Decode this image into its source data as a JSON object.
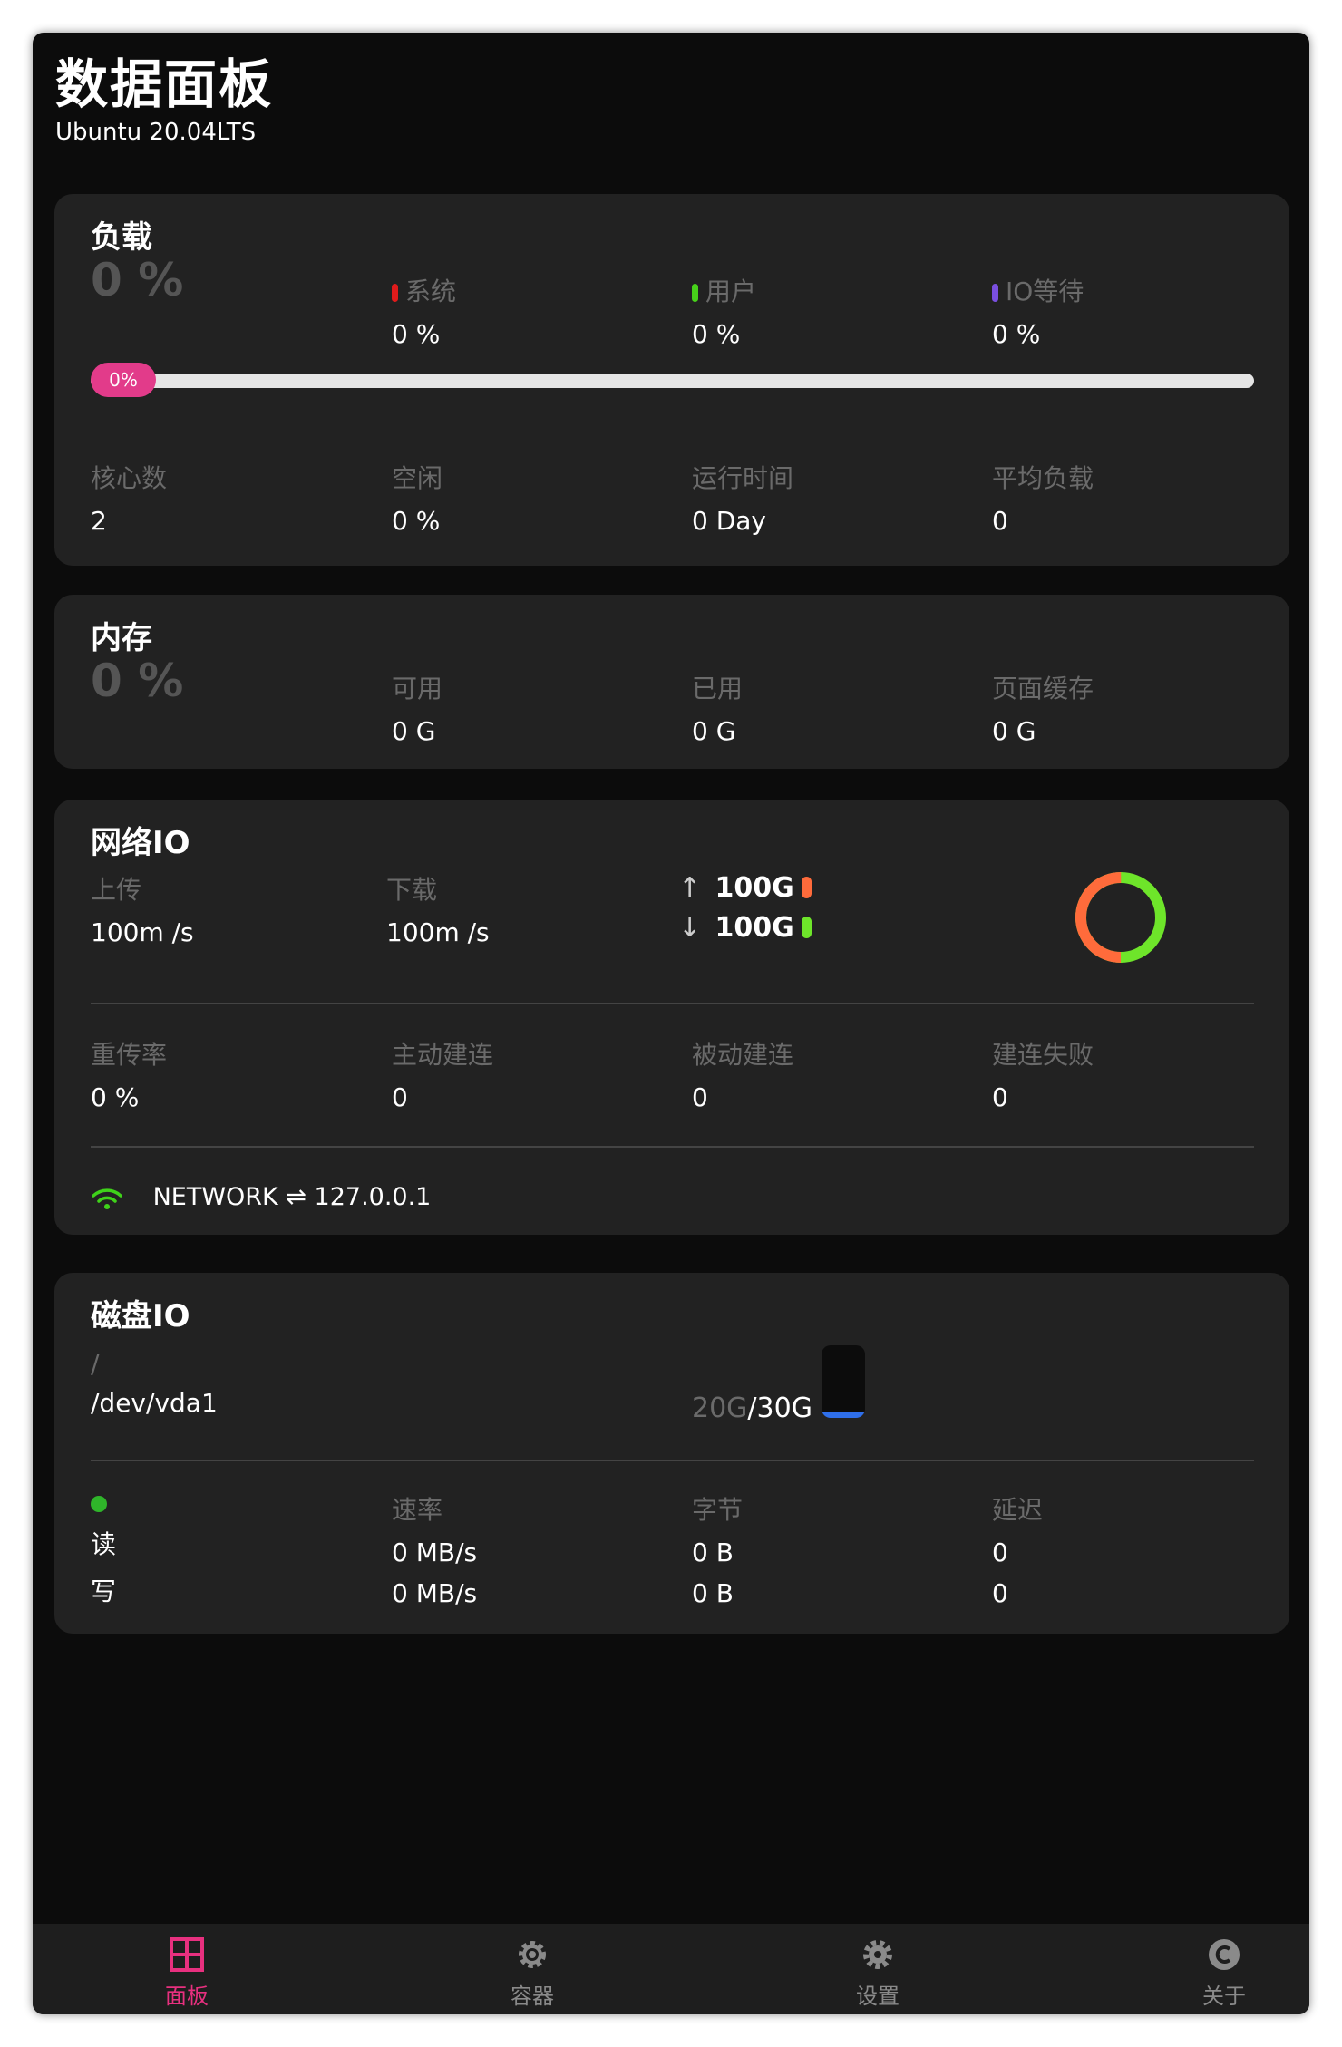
{
  "header": {
    "title": "数据面板",
    "subtitle": "Ubuntu 20.04LTS"
  },
  "load": {
    "title": "负载",
    "percent": "0 %",
    "usage_fraction": 0,
    "bar_label": "0%",
    "top_stats": [
      {
        "label": "系统",
        "value": "0 %",
        "color": "#e01b1b"
      },
      {
        "label": "用户",
        "value": "0 %",
        "color": "#47d21a"
      },
      {
        "label": "IO等待",
        "value": "0 %",
        "color": "#7a4fe0"
      }
    ],
    "bottom_stats": [
      {
        "label": "核心数",
        "value": "2"
      },
      {
        "label": "空闲",
        "value": "0 %"
      },
      {
        "label": "运行时间",
        "value": "0 Day"
      },
      {
        "label": "平均负载",
        "value": "0"
      }
    ]
  },
  "memory": {
    "title": "内存",
    "percent": "0 %",
    "stats": [
      {
        "label": "可用",
        "value": "0 G"
      },
      {
        "label": "已用",
        "value": "0 G"
      },
      {
        "label": "页面缓存",
        "value": "0 G"
      }
    ]
  },
  "network": {
    "title": "网络IO",
    "upload": {
      "label": "上传",
      "value": "100m /s"
    },
    "download": {
      "label": "下载",
      "value": "100m /s"
    },
    "totals": [
      {
        "arrow": "↑",
        "value": "100G",
        "color": "#ff6b3b"
      },
      {
        "arrow": "↓",
        "value": "100G",
        "color": "#6ee52a"
      }
    ],
    "ring": {
      "up_fraction": 0.5,
      "up_color": "#ff6b3b",
      "down_color": "#6ee52a"
    },
    "stats": [
      {
        "label": "重传率",
        "value": "0 %"
      },
      {
        "label": "主动建连",
        "value": "0"
      },
      {
        "label": "被动建连",
        "value": "0"
      },
      {
        "label": "建连失败",
        "value": "0"
      }
    ],
    "footer": "NETWORK ⇌ 127.0.0.1",
    "wifi_icon": "wifi-icon",
    "wifi_color": "#3fd21a"
  },
  "disk": {
    "title": "磁盘IO",
    "mount": "/",
    "device": "/dev/vda1",
    "used": "20G",
    "total": "/30G",
    "usage_fraction": 0.07,
    "bar_color": "#2f6fea",
    "status_color": "#2fb52a",
    "columns": [
      "速率",
      "字节",
      "延迟"
    ],
    "rows": [
      {
        "label": "读",
        "rate": "0 MB/s",
        "bytes": "0 B",
        "latency": "0"
      },
      {
        "label": "写",
        "rate": "0 MB/s",
        "bytes": "0 B",
        "latency": "0"
      }
    ]
  },
  "nav": {
    "active_color": "#e8307f",
    "items": [
      {
        "label": "面板",
        "icon": "grid-icon"
      },
      {
        "label": "容器",
        "icon": "gear-icon"
      },
      {
        "label": "设置",
        "icon": "gear-icon"
      },
      {
        "label": "关于",
        "icon": "copyright-icon"
      }
    ]
  }
}
